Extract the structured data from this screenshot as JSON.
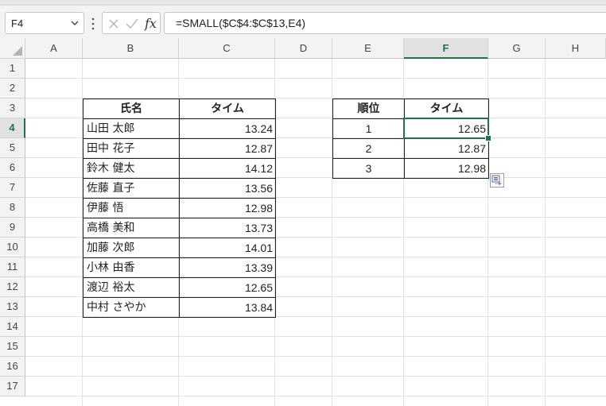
{
  "formula_bar": {
    "name_box": "F4",
    "formula": "=SMALL($C$4:$C$13,E4)",
    "fx_label": "fx"
  },
  "columns": [
    "A",
    "B",
    "C",
    "D",
    "E",
    "F",
    "G",
    "H"
  ],
  "active_column": "F",
  "rows": [
    "1",
    "2",
    "3",
    "4",
    "5",
    "6",
    "7",
    "8",
    "9",
    "10",
    "11",
    "12",
    "13",
    "14",
    "15",
    "16",
    "17"
  ],
  "active_row": "4",
  "left_table": {
    "header_name": "氏名",
    "header_time": "タイム",
    "rows": [
      {
        "name": "山田 太郎",
        "time": "13.24"
      },
      {
        "name": "田中 花子",
        "time": "12.87"
      },
      {
        "name": "鈴木 健太",
        "time": "14.12"
      },
      {
        "name": "佐藤 直子",
        "time": "13.56"
      },
      {
        "name": "伊藤 悟",
        "time": "12.98"
      },
      {
        "name": "高橋 美和",
        "time": "13.73"
      },
      {
        "name": "加藤 次郎",
        "time": "14.01"
      },
      {
        "name": "小林 由香",
        "time": "13.39"
      },
      {
        "name": "渡辺 裕太",
        "time": "12.65"
      },
      {
        "name": "中村 さやか",
        "time": "13.84"
      }
    ]
  },
  "right_table": {
    "header_rank": "順位",
    "header_time": "タイム",
    "rows": [
      {
        "rank": "1",
        "time": "12.65"
      },
      {
        "rank": "2",
        "time": "12.87"
      },
      {
        "rank": "3",
        "time": "12.98"
      }
    ]
  },
  "colors": {
    "accent": "#217346",
    "gridline": "#e1e1e1",
    "header_bg": "#f3f3f3"
  },
  "icons": {
    "name_box_dropdown": "chevron-down-icon",
    "more": "vertical-dots-icon",
    "cancel": "close-icon",
    "enter": "check-icon",
    "insert_function": "fx-icon",
    "paste_options": "paste-options-icon"
  }
}
